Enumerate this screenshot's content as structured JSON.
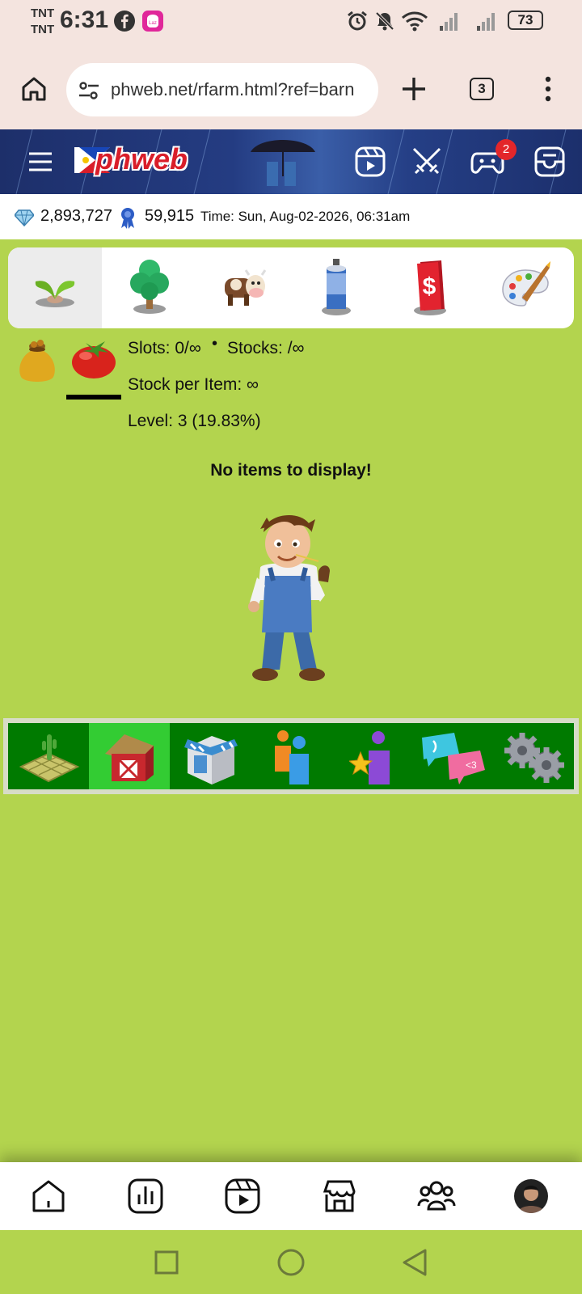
{
  "status_bar": {
    "carrier1": "TNT",
    "carrier2": "TNT",
    "time": "6:31",
    "battery": "73"
  },
  "browser": {
    "url": "phweb.net/rfarm.html?ref=barn",
    "tab_count": "3"
  },
  "site_header": {
    "logo_text": "phweb",
    "notification_count": "2"
  },
  "info_bar": {
    "gems": "2,893,727",
    "medals": "59,915",
    "time_label": "Time: Sun, Aug-02-2026, 06:31am"
  },
  "category_tabs": [
    "seeds",
    "trees",
    "animals",
    "tools",
    "currency",
    "decor"
  ],
  "barn": {
    "slots": "Slots: 0/∞",
    "stocks": "Stocks: /∞",
    "stock_per_item": "Stock per Item: ∞",
    "level": "Level: 3 (19.83%)",
    "empty_message": "No items to display!"
  },
  "farm_menu": [
    "farm",
    "barn",
    "shop",
    "neighbors",
    "achievements",
    "messages",
    "settings"
  ],
  "colors": {
    "grass": "#b3d44e",
    "menu_green": "#007a00",
    "menu_active": "#33cc33",
    "header_blue": "#243c82"
  }
}
